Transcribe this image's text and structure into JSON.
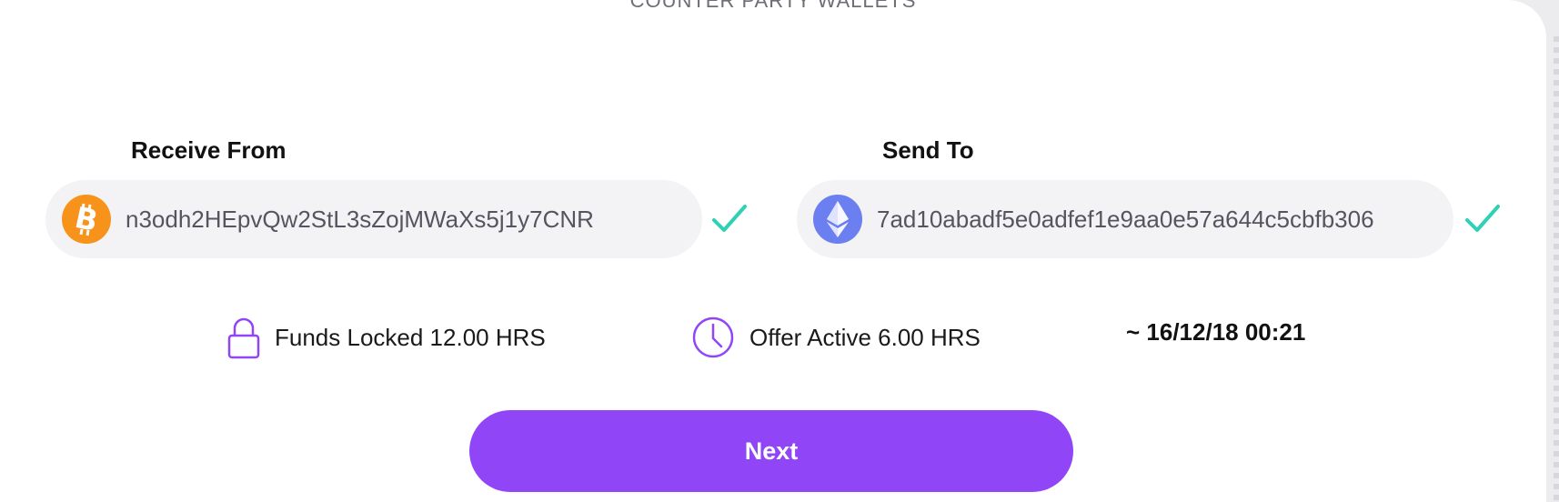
{
  "section": {
    "title": "COUNTER PARTY WALLETS"
  },
  "receive": {
    "label": "Receive From",
    "coin_icon": "bitcoin-icon",
    "address": "n3odh2HEpvQw2StL3sZojMWaXs5j1y7CNR",
    "status_icon": "checkmark-icon"
  },
  "send": {
    "label": "Send To",
    "coin_icon": "ethereum-icon",
    "address": "7ad10abadf5e0adfef1e9aa0e57a644c5cbfb306",
    "status_icon": "checkmark-icon"
  },
  "info": {
    "funds_locked": "Funds Locked 12.00 HRS",
    "offer_active": "Offer Active 6.00 HRS",
    "deadline": "~ 16/12/18 00:21"
  },
  "actions": {
    "next_label": "Next"
  },
  "colors": {
    "accent": "#9046f7",
    "check": "#2fd1b4",
    "bitcoin": "#f7931a",
    "ethereum": "#6b7ff0"
  }
}
